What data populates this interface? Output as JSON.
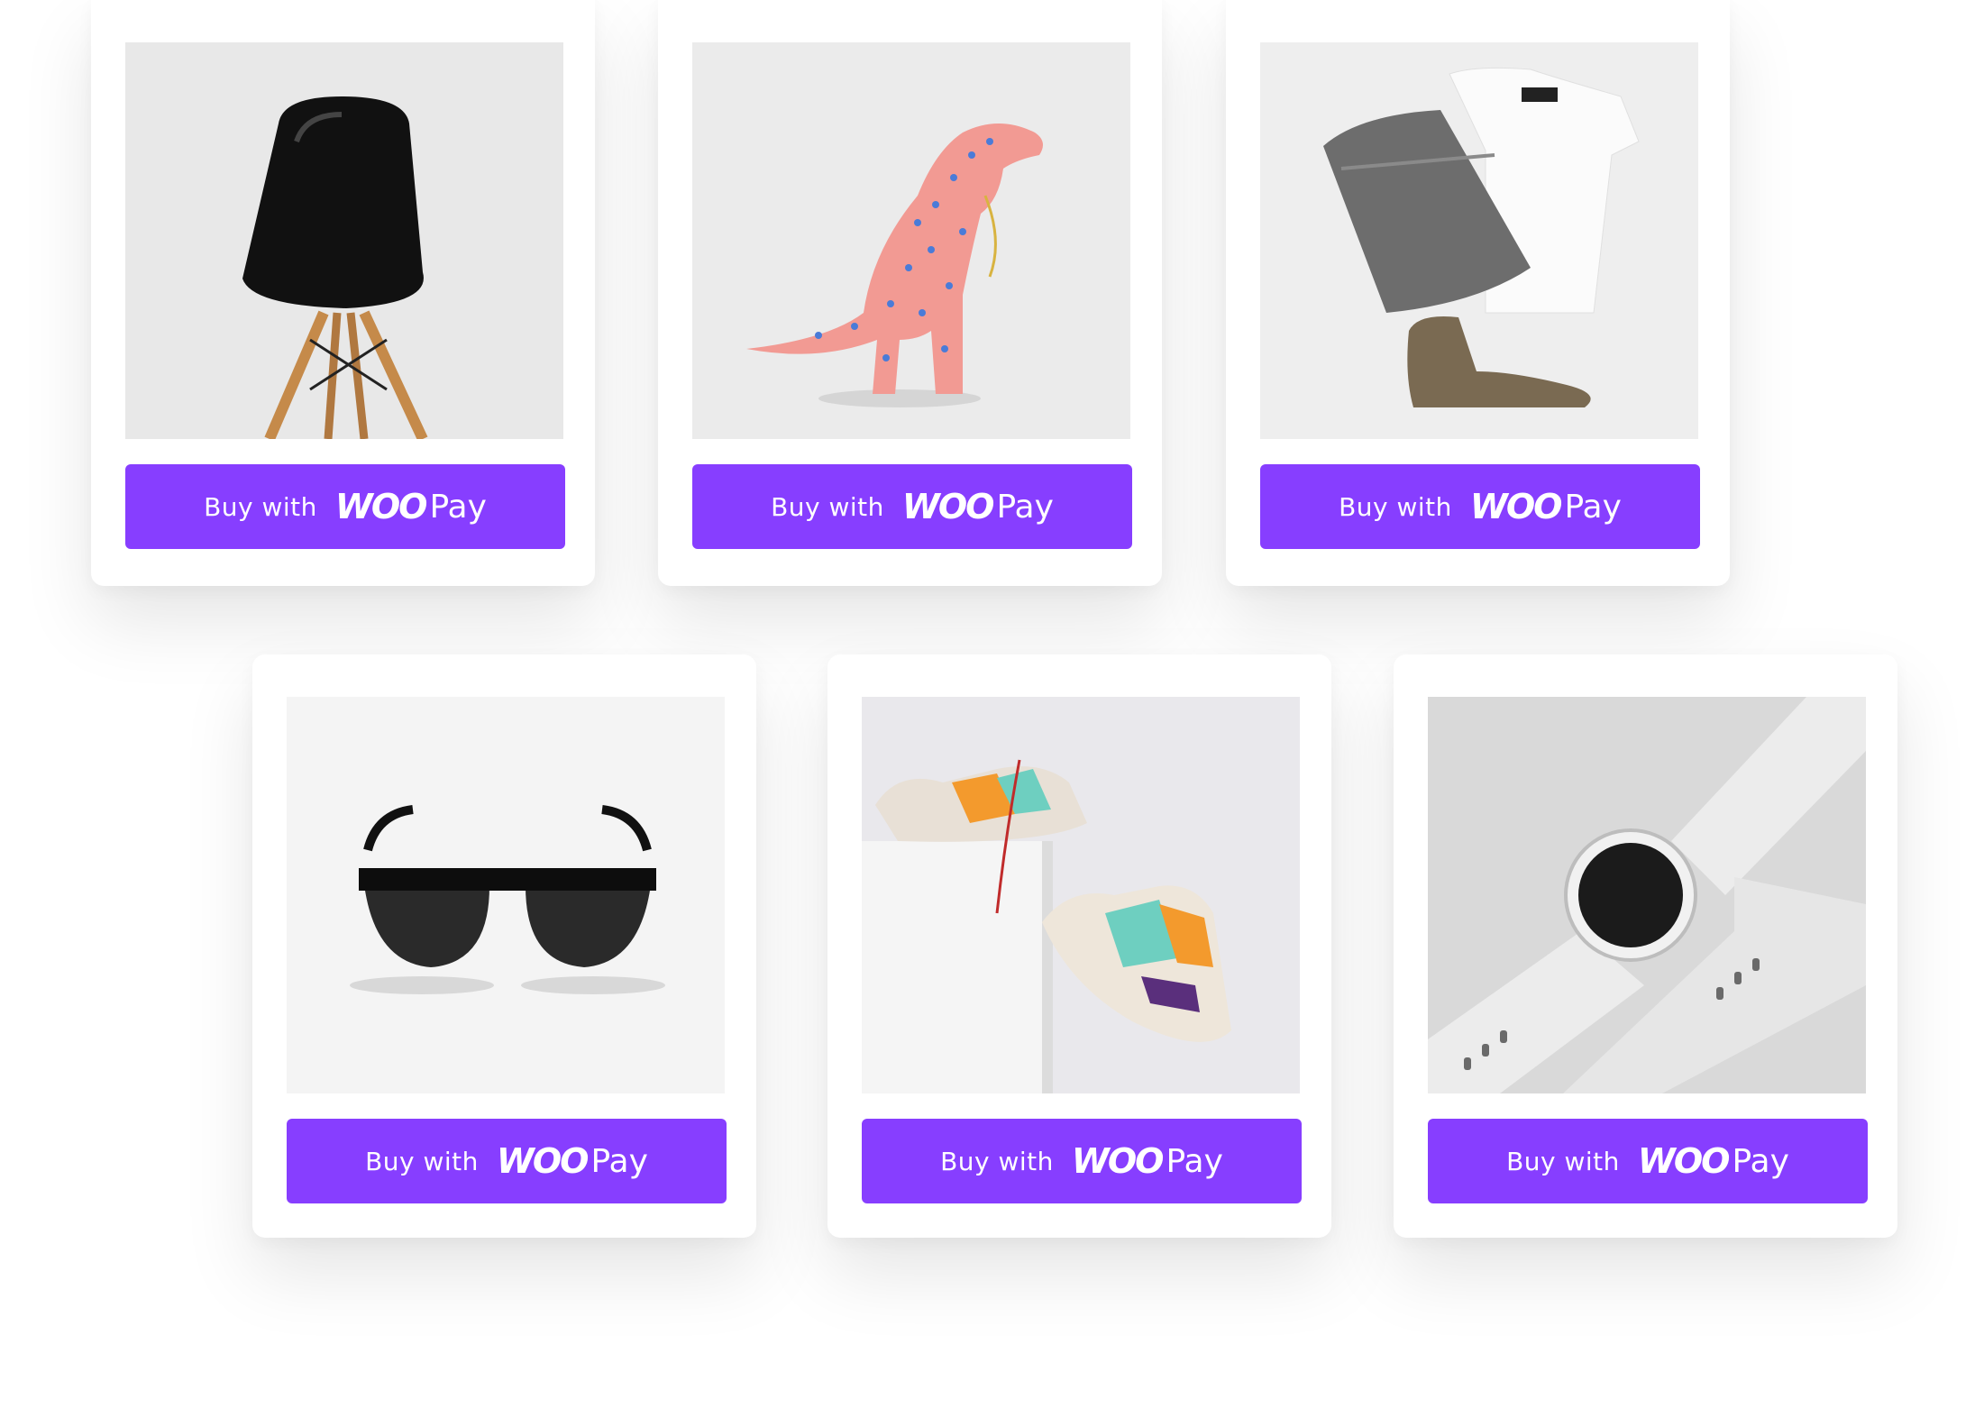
{
  "theme": {
    "button_color": "#873eff",
    "button_text_color": "#ffffff",
    "card_background": "#ffffff"
  },
  "products": [
    {
      "image": "black chair with wooden legs",
      "button": {
        "label": "Buy with",
        "brand_woo": "WOO",
        "brand_pay": "Pay"
      }
    },
    {
      "image": "pink dinosaur figurine with blue spots",
      "button": {
        "label": "Buy with",
        "brand_woo": "WOO",
        "brand_pay": "Pay"
      }
    },
    {
      "image": "folded jeans, white t-shirt and brown boots",
      "button": {
        "label": "Buy with",
        "brand_woo": "WOO",
        "brand_pay": "Pay"
      }
    },
    {
      "image": "black sunglasses",
      "button": {
        "label": "Buy with",
        "brand_woo": "WOO",
        "brand_pay": "Pay"
      }
    },
    {
      "image": "colorful sneakers on a white block",
      "button": {
        "label": "Buy with",
        "brand_woo": "WOO",
        "brand_pay": "Pay"
      }
    },
    {
      "image": "white smartwatch",
      "button": {
        "label": "Buy with",
        "brand_woo": "WOO",
        "brand_pay": "Pay"
      }
    }
  ]
}
